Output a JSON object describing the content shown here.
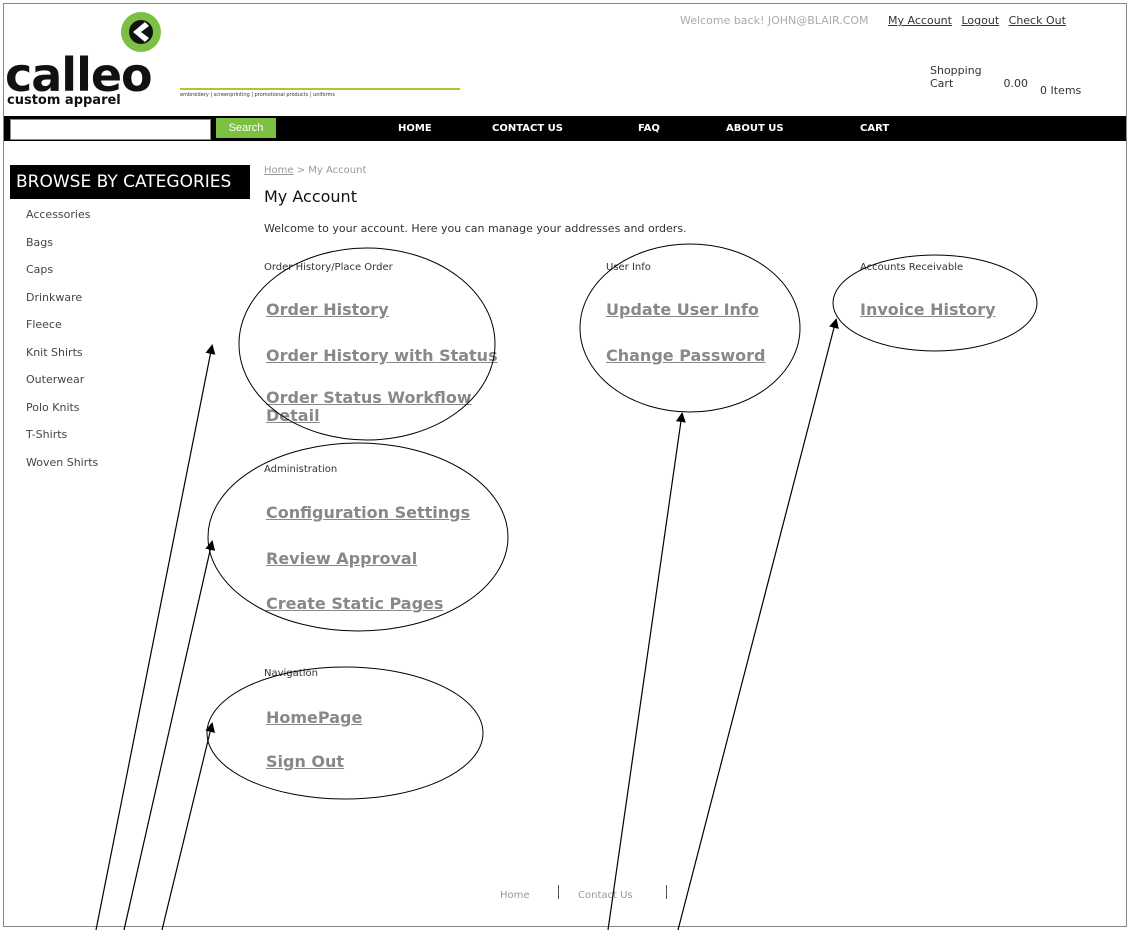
{
  "brand": {
    "word": "calleo",
    "subtitle": "custom apparel",
    "tagline": "embroidery | screenprinting | promotional products | uniforms",
    "accent": "#7bc043"
  },
  "top_links": {
    "welcome": "Welcome back! JOHN@BLAIR.COM",
    "my_account": "My Account",
    "logout": "Logout",
    "checkout": "Check Out"
  },
  "cart": {
    "label": "Shopping Cart",
    "amount": "0.00",
    "items": "0 Items"
  },
  "search": {
    "button": "Search",
    "value": ""
  },
  "nav": [
    "HOME",
    "CONTACT US",
    "FAQ",
    "ABOUT US",
    "CART"
  ],
  "sidebar": {
    "heading": "BROWSE BY CATEGORIES",
    "items": [
      "Accessories",
      "Bags",
      "Caps",
      "Drinkware",
      "Fleece",
      "Knit Shirts",
      "Outerwear",
      "Polo Knits",
      "T-Shirts",
      "Woven Shirts"
    ]
  },
  "breadcrumb": {
    "home": "Home",
    "sep": " > ",
    "current": "My Account"
  },
  "page_title": "My Account",
  "welcome_message": "Welcome to your account. Here you can manage your addresses and orders.",
  "sections": {
    "order": {
      "label": "Order History/Place Order",
      "links": [
        "Order History",
        "Order History with Status",
        "Order Status Workflow Detail"
      ]
    },
    "user": {
      "label": "User Info",
      "links": [
        "Update User Info",
        "Change Password"
      ]
    },
    "ar": {
      "label": "Accounts Receivable",
      "links": [
        "Invoice History"
      ]
    },
    "admin": {
      "label": "Administration",
      "links": [
        "Configuration Settings",
        "Review Approval",
        "Create Static Pages"
      ]
    },
    "navigation": {
      "label": "Navigation",
      "links": [
        "HomePage",
        "Sign Out"
      ]
    }
  },
  "footer": [
    "Home",
    "Contact Us"
  ]
}
